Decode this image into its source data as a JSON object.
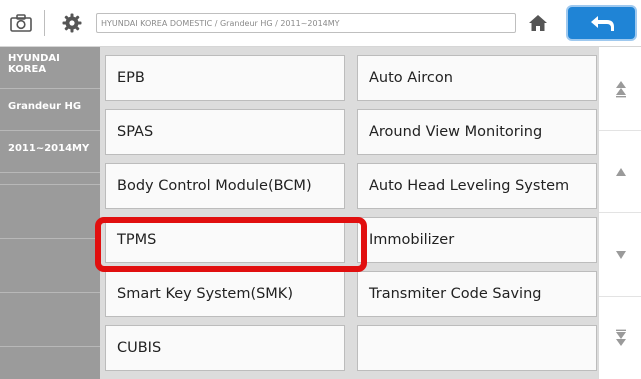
{
  "topbar": {
    "path": "HYUNDAI KOREA DOMESTIC / Grandeur HG / 2011~2014MY"
  },
  "sidebar": {
    "items": [
      {
        "label": "HYUNDAI KOREA"
      },
      {
        "label": "Grandeur HG"
      },
      {
        "label": "2011~2014MY"
      }
    ]
  },
  "systems": [
    {
      "label": "EPB"
    },
    {
      "label": "Auto Aircon"
    },
    {
      "label": "SPAS"
    },
    {
      "label": "Around View Monitoring"
    },
    {
      "label": "Body Control Module(BCM)"
    },
    {
      "label": "Auto Head Leveling System"
    },
    {
      "label": "TPMS"
    },
    {
      "label": "Immobilizer"
    },
    {
      "label": "Smart Key System(SMK)"
    },
    {
      "label": "Transmiter Code Saving"
    },
    {
      "label": "CUBIS"
    },
    {
      "label": ""
    }
  ],
  "icons": {
    "camera": "camera-icon",
    "settings": "gear-icon",
    "home": "home-icon",
    "back": "back-arrow-icon",
    "page_up": "double-chevron-up-icon",
    "scroll_up": "triangle-up-icon",
    "scroll_down": "triangle-down-icon",
    "page_down": "double-chevron-down-icon"
  },
  "colors": {
    "accent": "#1f84d6",
    "sidebar": "#9b9b9b",
    "highlight": "#e10f0f"
  }
}
